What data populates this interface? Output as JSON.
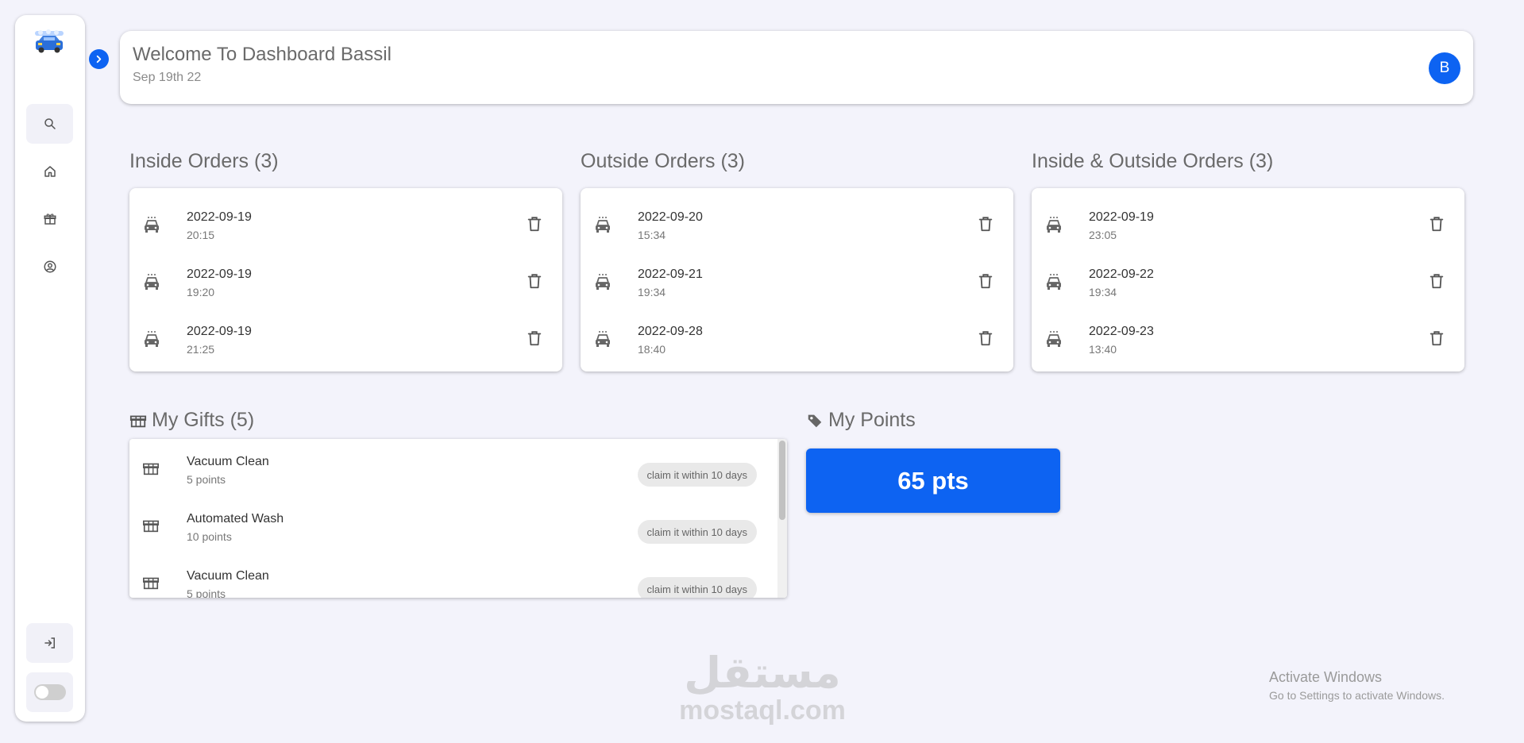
{
  "header": {
    "welcome": "Welcome To Dashboard Bassil",
    "date": "Sep 19th 22",
    "avatar_letter": "B"
  },
  "sidebar": {
    "items": [
      {
        "icon": "search-icon",
        "active": true
      },
      {
        "icon": "home-icon",
        "active": false
      },
      {
        "icon": "gift-icon",
        "active": false
      },
      {
        "icon": "user-circle-icon",
        "active": false
      }
    ]
  },
  "inside_orders": {
    "title": "Inside Orders (3)",
    "items": [
      {
        "date": "2022-09-19",
        "time": "20:15"
      },
      {
        "date": "2022-09-19",
        "time": "19:20"
      },
      {
        "date": "2022-09-19",
        "time": "21:25"
      }
    ]
  },
  "outside_orders": {
    "title": "Outside Orders (3)",
    "items": [
      {
        "date": "2022-09-20",
        "time": "15:34"
      },
      {
        "date": "2022-09-21",
        "time": "19:34"
      },
      {
        "date": "2022-09-28",
        "time": "18:40"
      }
    ]
  },
  "inout_orders": {
    "title": "Inside & Outside Orders (3)",
    "items": [
      {
        "date": "2022-09-19",
        "time": "23:05"
      },
      {
        "date": "2022-09-22",
        "time": "19:34"
      },
      {
        "date": "2022-09-23",
        "time": "13:40"
      }
    ]
  },
  "gifts": {
    "title": "My Gifts (5)",
    "items": [
      {
        "name": "Vacuum Clean",
        "points": "5 points",
        "claim": "claim it within 10 days"
      },
      {
        "name": "Automated Wash",
        "points": "10 points",
        "claim": "claim it within 10 days"
      },
      {
        "name": "Vacuum Clean",
        "points": "5 points",
        "claim": "claim it within 10 days"
      }
    ]
  },
  "points": {
    "title": "My Points",
    "value": "65 pts"
  },
  "watermark": {
    "arabic": "مستقل",
    "latin": "mostaql.com"
  },
  "windows_notice": {
    "title": "Activate Windows",
    "subtitle": "Go to Settings to activate Windows."
  },
  "colors": {
    "accent": "#0d63f2",
    "background": "#f3f3fb"
  }
}
